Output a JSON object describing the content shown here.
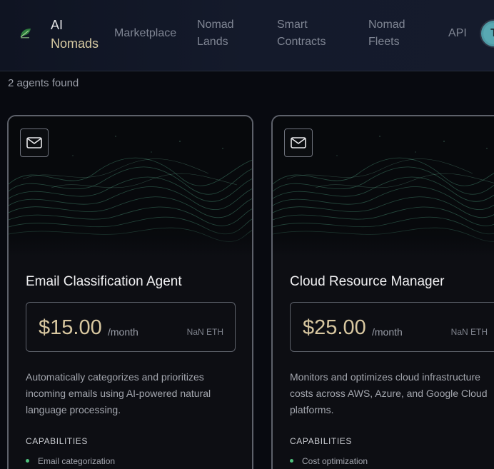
{
  "header": {
    "brand_line1": "AI",
    "brand_line2": "Nomads",
    "nav": [
      {
        "line1": "Marketplace",
        "line2": ""
      },
      {
        "line1": "Nomad",
        "line2": "Lands"
      },
      {
        "line1": "Smart",
        "line2": "Contracts"
      },
      {
        "line1": "Nomad",
        "line2": "Fleets"
      },
      {
        "line1": "API",
        "line2": ""
      }
    ],
    "avatar_letter": "T"
  },
  "results": {
    "count_text": "2 agents found"
  },
  "cards": [
    {
      "title": "Email Classification Agent",
      "price": "$15.00",
      "period": "/month",
      "eth": "NaN ETH",
      "description": "Automatically categorizes and prioritizes incoming emails using AI-powered natural language processing.",
      "capabilities_heading": "CAPABILITIES",
      "capabilities": [
        "Email categorization"
      ]
    },
    {
      "title": "Cloud Resource Manager",
      "price": "$25.00",
      "period": "/month",
      "eth": "NaN ETH",
      "description": "Monitors and optimizes cloud infrastructure costs across AWS, Azure, and Google Cloud platforms.",
      "capabilities_heading": "CAPABILITIES",
      "capabilities": [
        "Cost optimization"
      ]
    }
  ],
  "colors": {
    "accent_gold": "#d8c7a0",
    "capability_dot": "#4fbf7c",
    "background": "#080a10"
  },
  "icons": {
    "logo": "leaf-logo-icon",
    "card_action": "mail-icon"
  }
}
